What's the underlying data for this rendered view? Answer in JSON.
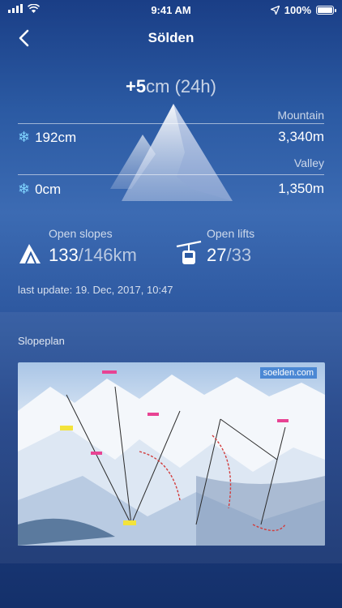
{
  "status": {
    "time": "9:41 AM",
    "battery": "100%",
    "battery_level": 1.0
  },
  "nav": {
    "title": "Sölden"
  },
  "snow_24h": {
    "value": "+5",
    "unit": "cm (24h)"
  },
  "mountain": {
    "label": "Mountain",
    "snow": "192cm",
    "elevation": "3,340m"
  },
  "valley": {
    "label": "Valley",
    "snow": "0cm",
    "elevation": "1,350m"
  },
  "slopes": {
    "label": "Open slopes",
    "open": "133",
    "total": "/146km"
  },
  "lifts": {
    "label": "Open lifts",
    "open": "27",
    "total": "/33"
  },
  "last_update": "last update: 19. Dec, 2017, 10:47",
  "slopeplan": {
    "title": "Slopeplan",
    "brand": "soelden.com"
  },
  "colors": {
    "accent_snow": "#7fd3ff"
  },
  "icons": {
    "back": "chevron-left-icon",
    "snow": "snowflake-icon",
    "slopes": "ski-slope-icon",
    "lifts": "gondola-icon"
  }
}
